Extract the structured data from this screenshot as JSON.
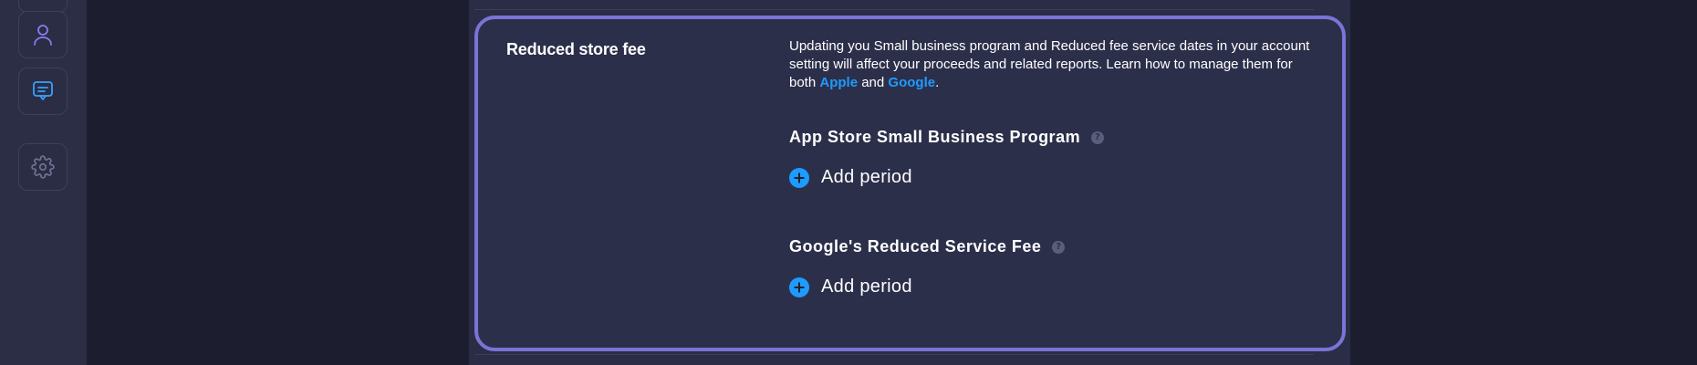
{
  "sidebar": {
    "items": [
      {
        "icon": "user-icon",
        "color": "#8b7cf0"
      },
      {
        "icon": "chat-icon",
        "color": "#3aa0ff"
      },
      {
        "icon": "gear-icon",
        "color": "#6e7290"
      }
    ]
  },
  "section": {
    "title": "Reduced store fee",
    "description_text": "Updating you Small business program and Reduced fee service dates in your account setting will affect your proceeds and related reports. Learn how to manage them for both ",
    "link_apple": "Apple",
    "conjunction": " and ",
    "link_google": "Google",
    "period_char": "."
  },
  "programs": {
    "apple": {
      "title": "App Store Small Business Program",
      "help_glyph": "?",
      "add_label": "Add period"
    },
    "google": {
      "title": "Google's Reduced Service Fee",
      "help_glyph": "?",
      "add_label": "Add period"
    }
  },
  "colors": {
    "accent_border": "#7b73d6",
    "link": "#1e9bff",
    "add_icon": "#1e9bff"
  }
}
